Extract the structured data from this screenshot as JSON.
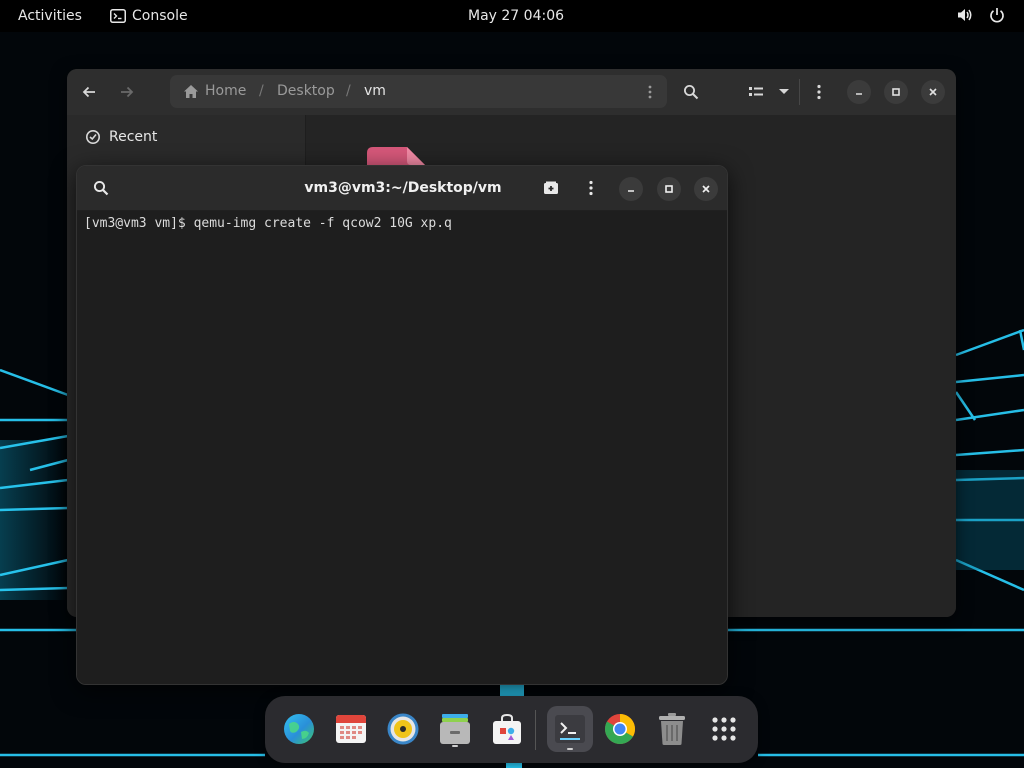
{
  "topbar": {
    "activities": "Activities",
    "app_name": "Console",
    "clock": "May 27  04:06"
  },
  "files": {
    "path": [
      "Home",
      "Desktop",
      "vm"
    ],
    "separator": "/",
    "sidebar": {
      "recent": "Recent"
    }
  },
  "terminal": {
    "title": "vm3@vm3:~/Desktop/vm",
    "prompt": "[vm3@vm3 vm]$ ",
    "command": "qemu-img create -f qcow2 10G xp.q"
  },
  "dock": {
    "items": [
      "browser-icon",
      "calendar-icon",
      "music-icon",
      "files-icon",
      "software-icon",
      "terminal-icon",
      "chrome-icon",
      "trash-icon",
      "app-grid-icon"
    ]
  },
  "colors": {
    "accent": "#3daee9",
    "window_bg": "#242424",
    "terminal_bg": "#1e1e1e"
  }
}
